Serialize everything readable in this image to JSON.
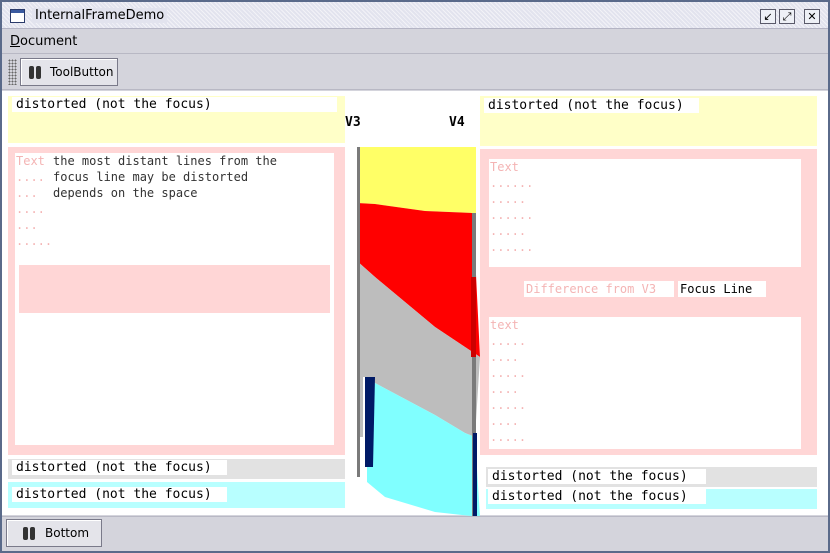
{
  "window": {
    "title": "InternalFrameDemo",
    "buttons": [
      "↙",
      "⤢",
      "✕"
    ]
  },
  "menubar": {
    "items": [
      "Document"
    ]
  },
  "toolbar": {
    "button_label": "ToolButton"
  },
  "left": {
    "top_label": "distorted (not the focus)",
    "ghost_text": "Text",
    "ghost_dots": [
      "....",
      "...",
      "....",
      "...",
      "....."
    ],
    "note_lines": [
      "the most distant lines from the",
      "focus line may be distorted",
      "depends on the space"
    ],
    "bottom_label_1": "distorted (not the focus)",
    "bottom_label_2": "distorted (not the focus)"
  },
  "center": {
    "v3": "V3",
    "v4": "V4"
  },
  "right": {
    "top_label": "distorted (not the focus)",
    "ghost_text_1": "Text",
    "ghost_dots_1": [
      "......",
      ".....",
      "......",
      ".....",
      "......"
    ],
    "difference_label": "Difference from V3",
    "focus_label": "Focus Line",
    "ghost_text_2": "text",
    "ghost_dots_2": [
      ".....",
      "....",
      ".....",
      "....",
      ".....",
      "....",
      "....."
    ],
    "bottom_label_1": "distorted (not the focus)",
    "bottom_label_2": "distorted (not the focus)"
  },
  "statusbar": {
    "button_label": "Bottom"
  },
  "colors": {
    "yellow": "#ffff66",
    "red": "#ff0000",
    "gray": "#bdbdbd",
    "cyan": "#80ffff",
    "navy": "#001a66",
    "pink_panel": "#ffd6d6",
    "yellow_panel": "#ffffc8"
  }
}
